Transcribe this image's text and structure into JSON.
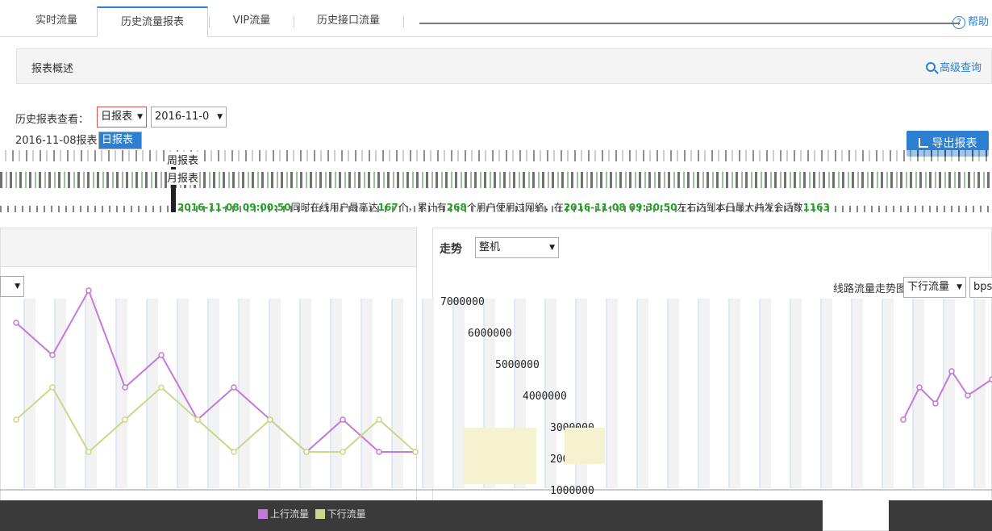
{
  "tabs": [
    {
      "label": "实时流量"
    },
    {
      "label": "历史流量报表",
      "active": true
    },
    {
      "label": "VIP流量"
    },
    {
      "label": "历史接口流量"
    }
  ],
  "help": {
    "label": "帮助"
  },
  "overview": {
    "title": "报表概述",
    "advanced_query": "高级查询"
  },
  "history": {
    "label": "历史报表查看：",
    "report_type": "日报表",
    "date_value": "2016-11-0",
    "report_date_text": "2016-11-08报表",
    "options": [
      "日报表",
      "周报表",
      "月报表"
    ]
  },
  "export": {
    "label": "导出报表"
  },
  "summary": {
    "prefix": "在",
    "time1": "2016-11-08 09:00:50",
    "mid1": "同时在线用户最高达",
    "peak": "167",
    "mid2": "个，累计有",
    "total": "268",
    "mid3": "个用户使用过网络，在",
    "time2": "2016-11-08 09:30:50",
    "mid4": "左右达到本日最大并发会话数",
    "sessions": "1163"
  },
  "trend": {
    "label": "走势",
    "scope": "整机"
  },
  "line_chart": {
    "label": "线路流量走势图",
    "direction": "下行流量",
    "unit": "bps"
  },
  "left_select": {
    "value": ""
  },
  "colors": {
    "accent": "#2d7fd0",
    "highlight": "#22a322",
    "series_up": "#c37ad9",
    "series_down": "#c9d98a"
  },
  "chart_data": {
    "type": "line",
    "title": "线路流量走势图",
    "yticks": [
      7000000,
      6000000,
      5000000,
      4000000,
      3000000,
      2000000,
      1000000
    ],
    "series": [
      {
        "name": "上行流量",
        "values": [
          5,
          4,
          6,
          3,
          4,
          2,
          3,
          2,
          1,
          2,
          1,
          1
        ]
      },
      {
        "name": "下行流量",
        "values": [
          2,
          3,
          1,
          2,
          3,
          2,
          1,
          2,
          1,
          1,
          2,
          1
        ]
      }
    ]
  }
}
